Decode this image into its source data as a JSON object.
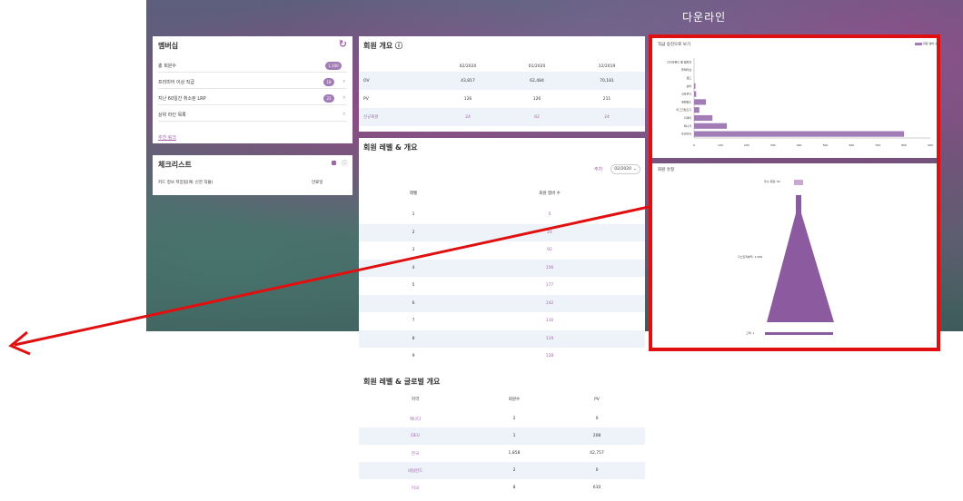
{
  "header": {
    "title": "다운라인"
  },
  "membership": {
    "title": "멤버십",
    "rows": [
      {
        "label": "총 회원수",
        "value": "1,100",
        "arrow": false
      },
      {
        "label": "프리미어 이상 직급",
        "value": "18",
        "arrow": true
      },
      {
        "label": "지난 60일간 취소된 LRP",
        "value": "22",
        "arrow": true
      },
      {
        "label": "상위 라인 목록",
        "value": "",
        "arrow": true
      }
    ],
    "link": "추천 링크"
  },
  "checklist": {
    "title": "체크리스트",
    "item_label": "카드 정보 저장됨(예: 신한 직불)",
    "item_status": "만료일"
  },
  "overview": {
    "title": "회원 개요 ⓘ",
    "columns": [
      "02/2020",
      "01/2020",
      "12/2019"
    ],
    "rows": [
      {
        "label": "OV",
        "values": [
          "43,817",
          "62,484",
          "70,181"
        ]
      },
      {
        "label": "PV",
        "values": [
          "126",
          "126",
          "211"
        ]
      },
      {
        "label": "신규회원",
        "values": [
          "24",
          "62",
          "24"
        ]
      }
    ]
  },
  "level_summary": {
    "title": "회원 레벨 & 개요",
    "week_label": "주차",
    "week_value": "02/2020",
    "col_level": "레벨",
    "col_count": "회원 멤버 수",
    "rows": [
      {
        "level": "1",
        "count": "5"
      },
      {
        "level": "2",
        "count": "24"
      },
      {
        "level": "3",
        "count": "92"
      },
      {
        "level": "4",
        "count": "156"
      },
      {
        "level": "5",
        "count": "177"
      },
      {
        "level": "6",
        "count": "142"
      },
      {
        "level": "7",
        "count": "116"
      },
      {
        "level": "8",
        "count": "119"
      },
      {
        "level": "9",
        "count": "128"
      }
    ]
  },
  "global_summary": {
    "title": "회원 레벨 & 글로벌 개요",
    "columns": [
      "지역",
      "회원수",
      "PV"
    ],
    "rows": [
      {
        "region": "캐나다",
        "members": "2",
        "pv": "0"
      },
      {
        "region": "DEU",
        "members": "1",
        "pv": "208"
      },
      {
        "region": "한국",
        "members": "1,858",
        "pv": "42,757"
      },
      {
        "region": "네덜란드",
        "members": "2",
        "pv": "0"
      },
      {
        "region": "미국",
        "members": "8",
        "pv": "610"
      }
    ]
  },
  "chart_data": [
    {
      "type": "bar",
      "title": "직급 승진으로 보기",
      "legend": "회원 멤버 수",
      "categories": [
        "다이아몬드 웰 챔피언",
        "플래티넘",
        "골드",
        "실버",
        "크라우디",
        "에메랄드",
        "마그크랜드디",
        "디렉터",
        "매니저",
        "프리미어"
      ],
      "values": [
        0,
        0,
        0,
        5,
        8,
        45,
        20,
        70,
        125,
        800
      ],
      "xlim": [
        0,
        900
      ],
      "xticks": [
        "0",
        "100",
        "200",
        "300",
        "400",
        "500",
        "600",
        "700",
        "800",
        "900"
      ]
    },
    {
      "type": "funnel",
      "title": "회원 유형",
      "labels": [
        "우수 회원: 62",
        "디스트리뷰터: 1,006",
        "고객: 1"
      ]
    }
  ],
  "colors": {
    "accent": "#a065a8",
    "bar": "#a27cb6",
    "highlight": "#e01010",
    "row_alt": "#eef3fa"
  }
}
